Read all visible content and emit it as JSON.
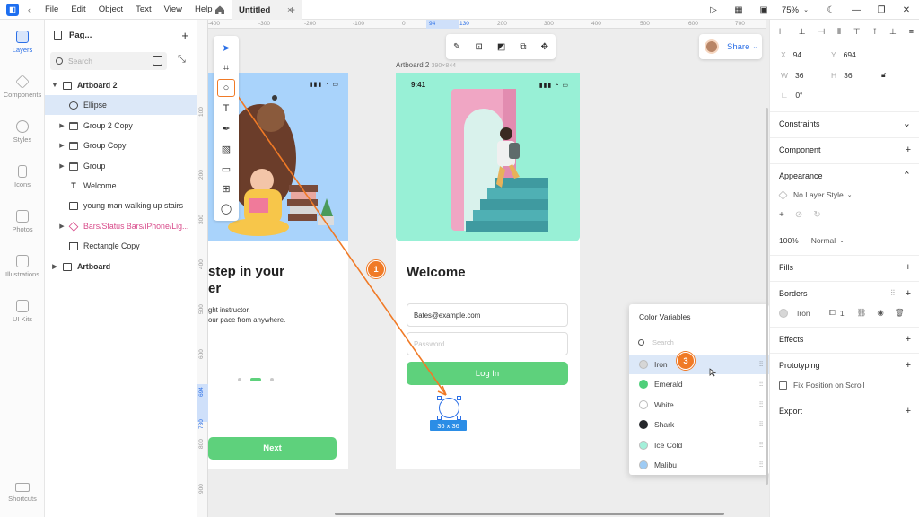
{
  "menubar": {
    "items": [
      "File",
      "Edit",
      "Object",
      "Text",
      "View",
      "Help"
    ],
    "doc_tab": "Untitled",
    "zoom": "75%"
  },
  "rail": [
    {
      "label": "Layers"
    },
    {
      "label": "Components"
    },
    {
      "label": "Styles"
    },
    {
      "label": "Icons"
    },
    {
      "label": "Photos"
    },
    {
      "label": "Illustrations"
    },
    {
      "label": "UI Kits"
    },
    {
      "label": "Shortcuts"
    }
  ],
  "layers_panel": {
    "page_label": "Pag...",
    "search_placeholder": "Search",
    "items": [
      {
        "label": "Artboard 2",
        "icon": "artboard-icon"
      },
      {
        "label": "Ellipse",
        "icon": "ellipse-icon"
      },
      {
        "label": "Group 2 Copy",
        "icon": "folder-icon"
      },
      {
        "label": "Group Copy",
        "icon": "folder-icon"
      },
      {
        "label": "Group",
        "icon": "folder-icon"
      },
      {
        "label": "Welcome",
        "icon": "text-icon"
      },
      {
        "label": "young man walking up stairs",
        "icon": "image-icon"
      },
      {
        "label": "Bars/Status Bars/iPhone/Lig...",
        "icon": "symbol-icon"
      },
      {
        "label": "Rectangle Copy",
        "icon": "rectangle-icon"
      },
      {
        "label": "Artboard",
        "icon": "artboard-icon"
      }
    ]
  },
  "ruler_top": [
    "-400",
    "-300",
    "-200",
    "-100",
    "0",
    "100",
    "200",
    "300",
    "400",
    "500",
    "600",
    "700",
    "800",
    "94",
    "130"
  ],
  "ruler_left": [
    "100",
    "200",
    "300",
    "400",
    "500",
    "600",
    "694",
    "730",
    "800",
    "900"
  ],
  "share": {
    "label": "Share"
  },
  "artboard1": {
    "title_line1": "step in your",
    "title_line2": "er",
    "sub_line1": "ght instructor.",
    "sub_line2": "our pace from anywhere.",
    "next_label": "Next"
  },
  "artboard2": {
    "label": "Artboard 2",
    "dims": "390×844",
    "status_time": "9:41",
    "welcome": "Welcome",
    "email_value": "Bates@example.com",
    "password_placeholder": "Password",
    "login_label": "Log In"
  },
  "selection": {
    "size_label": "36 x 36"
  },
  "badges": [
    "1",
    "2",
    "3"
  ],
  "color_variables": {
    "title": "Color Variables",
    "search_placeholder": "Search",
    "items": [
      {
        "name": "Iron",
        "color": "#d6d6d6"
      },
      {
        "name": "Emerald",
        "color": "#4fcf7a"
      },
      {
        "name": "White",
        "color": "#ffffff"
      },
      {
        "name": "Shark",
        "color": "#25272b"
      },
      {
        "name": "Ice Cold",
        "color": "#a3f0da"
      },
      {
        "name": "Malibu",
        "color": "#9ecbf4"
      }
    ]
  },
  "properties": {
    "x_label": "X",
    "x_value": "94",
    "y_label": "Y",
    "y_value": "694",
    "w_label": "W",
    "w_value": "36",
    "h_label": "H",
    "h_value": "36",
    "rotation": "0°",
    "constraints": "Constraints",
    "component": "Component",
    "appearance": "Appearance",
    "layer_style": "No Layer Style",
    "opacity": "100%",
    "blend": "Normal",
    "fills": "Fills",
    "borders": "Borders",
    "border_color_name": "Iron",
    "border_width": "1",
    "effects": "Effects",
    "prototyping": "Prototyping",
    "fix_position": "Fix Position on Scroll",
    "export": "Export"
  }
}
